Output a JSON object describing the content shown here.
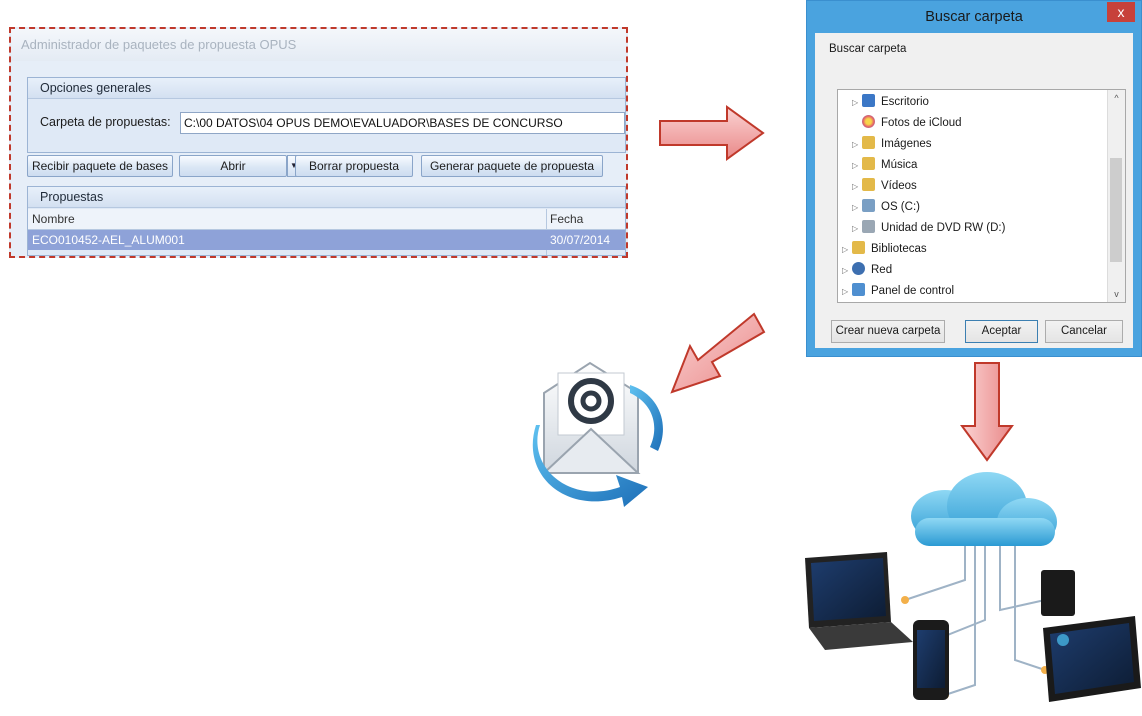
{
  "opus": {
    "title": "Administrador de paquetes de propuesta OPUS",
    "general_group": "Opciones generales",
    "folder_label": "Carpeta de propuestas:",
    "folder_value": "C:\\00 DATOS\\04 OPUS DEMO\\EVALUADOR\\BASES DE CONCURSO",
    "buttons": {
      "receive": "Recibir paquete de bases",
      "open": "Abrir",
      "delete": "Borrar propuesta",
      "generate": "Generar paquete de propuesta"
    },
    "proposals_group": "Propuestas",
    "columns": [
      "Nombre",
      "Fecha"
    ],
    "rows": [
      {
        "name": "ECO010452-AEL_ALUM001",
        "date": "30/07/2014"
      }
    ]
  },
  "dialog": {
    "title": "Buscar carpeta",
    "close": "x",
    "subtitle": "Buscar carpeta",
    "tree": [
      {
        "label": "Escritorio",
        "icon": "desktop-folder-icon",
        "color": "#3b77c6"
      },
      {
        "label": "Fotos de iCloud",
        "icon": "icloud-photos-icon",
        "color": "#f0a020"
      },
      {
        "label": "Imágenes",
        "icon": "pictures-folder-icon",
        "color": "#e3b949"
      },
      {
        "label": "Música",
        "icon": "music-folder-icon",
        "color": "#e3b949"
      },
      {
        "label": "Vídeos",
        "icon": "videos-folder-icon",
        "color": "#e3b949"
      },
      {
        "label": "OS (C:)",
        "icon": "drive-icon",
        "color": "#7a9fc4"
      },
      {
        "label": "Unidad de DVD RW (D:)",
        "icon": "dvd-drive-icon",
        "color": "#9aa7b4"
      },
      {
        "label": "Bibliotecas",
        "icon": "libraries-icon",
        "color": "#e3b949"
      },
      {
        "label": "Red",
        "icon": "network-icon",
        "color": "#3d6fb0"
      },
      {
        "label": "Panel de control",
        "icon": "control-panel-icon",
        "color": "#4f8fd0"
      }
    ],
    "buttons": {
      "new_folder": "Crear nueva carpeta",
      "accept": "Aceptar",
      "cancel": "Cancelar"
    }
  },
  "colors": {
    "arrow_fill": "#f3a3a3",
    "arrow_stroke": "#c0392b",
    "selection": "#8ea2d8",
    "dialog_frame": "#4aa3df"
  },
  "illustrations": {
    "mail": "email-at-icon",
    "cloud": "cloud-devices-icon",
    "arrows": [
      "right-arrow-icon",
      "down-left-arrow-icon",
      "down-arrow-icon"
    ]
  }
}
